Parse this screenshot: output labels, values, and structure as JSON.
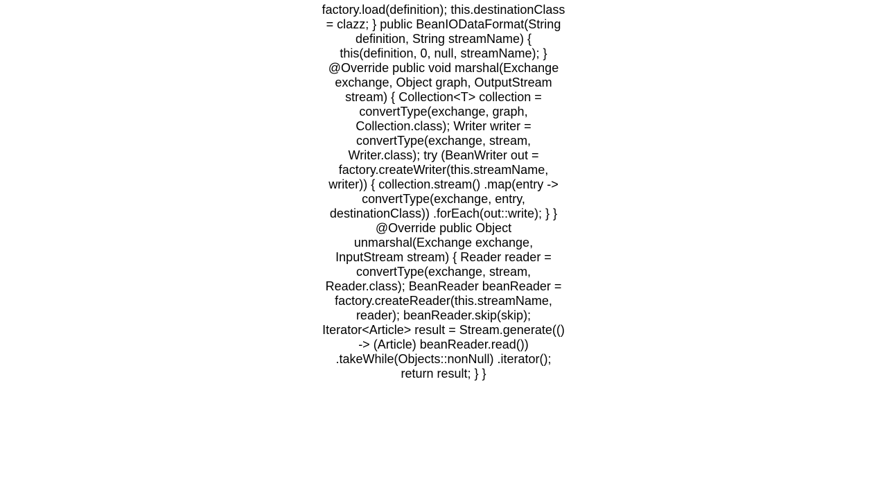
{
  "code": "factory.load(definition);         this.destinationClass = clazz;     }      public BeanIODataFormat(String definition, String streamName) {         this(definition, 0, null, streamName);     }      @Override     public void marshal(Exchange exchange, Object graph, OutputStream stream) {         Collection<T> collection = convertType(exchange, graph, Collection.class);          Writer writer = convertType(exchange, stream, Writer.class);          try (BeanWriter out = factory.createWriter(this.streamName, writer)) {             collection.stream()                     .map(entry -> convertType(exchange, entry, destinationClass))                     .forEach(out::write);         }     }      @Override     public Object unmarshal(Exchange exchange, InputStream stream) {          Reader reader = convertType(exchange, stream, Reader.class);          BeanReader beanReader = factory.createReader(this.streamName, reader);          beanReader.skip(skip);          Iterator<Article> result = Stream.generate(() -> (Article) beanReader.read())                 .takeWhile(Objects::nonNull)                 .iterator();          return result;     } }"
}
